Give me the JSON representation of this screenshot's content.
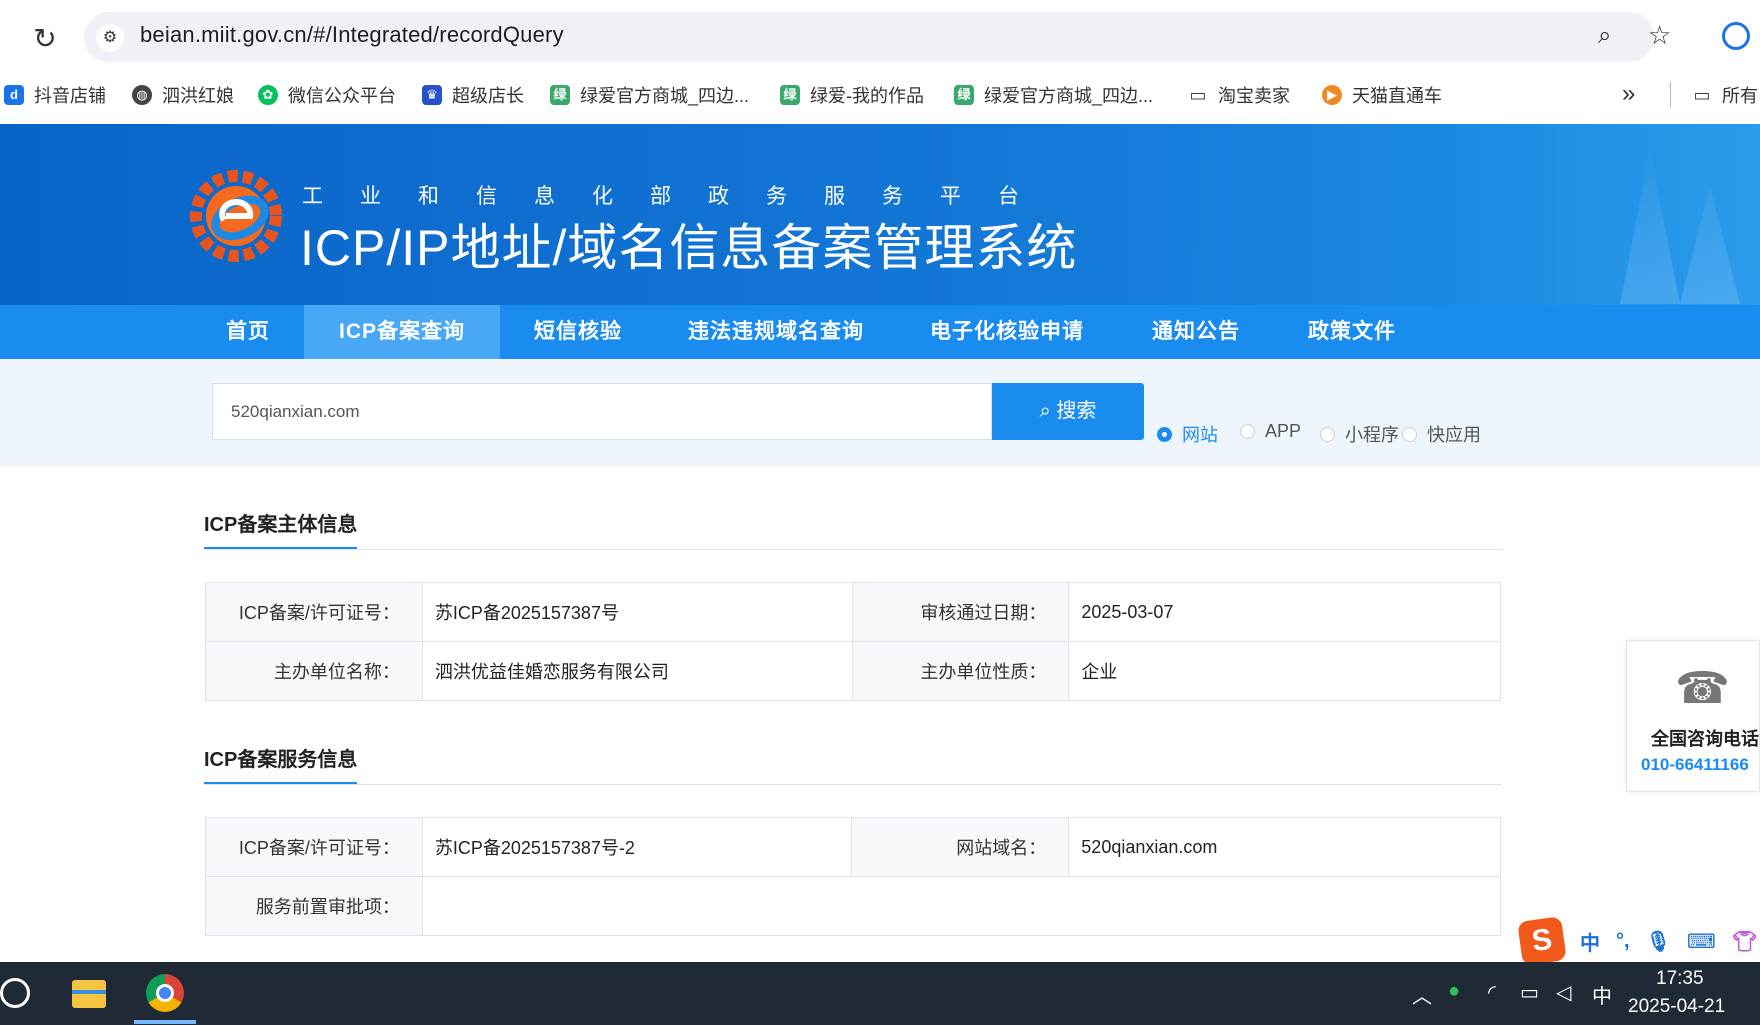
{
  "browser": {
    "url": "beian.miit.gov.cn/#/Integrated/recordQuery",
    "bookmarks": [
      "抖音店铺",
      "泗洪红娘",
      "微信公众平台",
      "超级店长",
      "绿爱官方商城_四边...",
      "绿爱-我的作品",
      "绿爱官方商城_四边...",
      "淘宝卖家",
      "天猫直通车",
      "所有"
    ],
    "bookmarks_more": "»"
  },
  "banner": {
    "subtitle": "工业和信息化部政务服务平台",
    "title": "ICP/IP地址/域名信息备案管理系统"
  },
  "nav": {
    "items": [
      "首页",
      "ICP备案查询",
      "短信核验",
      "违法违规域名查询",
      "电子化核验申请",
      "通知公告",
      "政策文件"
    ],
    "active_index": 1
  },
  "search": {
    "value": "520qianxian.com",
    "button_label": "搜索",
    "options": [
      "网站",
      "APP",
      "小程序",
      "快应用"
    ],
    "selected_option": "网站"
  },
  "subject_info": {
    "title": "ICP备案主体信息",
    "license_label": "ICP备案/许可证号：",
    "license_value": "苏ICP备2025157387号",
    "approve_date_label": "审核通过日期：",
    "approve_date_value": "2025-03-07",
    "org_name_label": "主办单位名称：",
    "org_name_value": "泗洪优益佳婚恋服务有限公司",
    "org_type_label": "主办单位性质：",
    "org_type_value": "企业"
  },
  "service_info": {
    "title": "ICP备案服务信息",
    "license_label": "ICP备案/许可证号：",
    "license_value": "苏ICP备2025157387号-2",
    "domain_label": "网站域名：",
    "domain_value": "520qianxian.com",
    "preapproval_label": "服务前置审批项：",
    "preapproval_value": ""
  },
  "side_contact": {
    "title": "全国咨询电话",
    "phone": "010-66411166"
  },
  "ime": {
    "logo": "S",
    "mode": "中",
    "punct": "°,"
  },
  "taskbar": {
    "ime_indicator": "中",
    "time": "17:35",
    "date": "2025-04-21"
  },
  "colors": {
    "primary": "#1a8cf0",
    "banner": "#1377d6",
    "nav_active": "#48a8f6",
    "search_band": "#eef5fc"
  }
}
